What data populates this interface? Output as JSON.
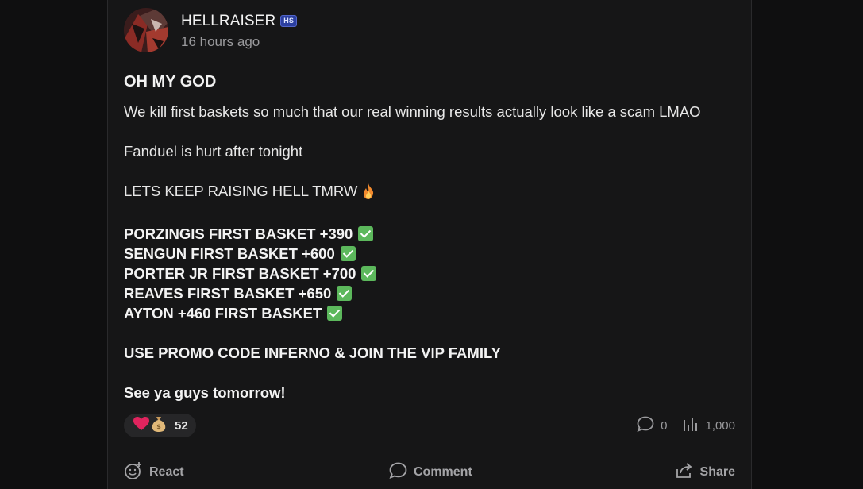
{
  "post": {
    "author": "HELLRAISER",
    "badge": "HS",
    "timestamp": "16 hours ago",
    "title": "OH MY GOD",
    "paragraphs": {
      "p1": "We kill first baskets so much that our real winning results actually look like a scam LMAO",
      "p2": "Fanduel is hurt after tonight",
      "p3": "LETS KEEP RAISING HELL TMRW"
    },
    "picks": [
      "PORZINGIS FIRST BASKET +390",
      "SENGUN FIRST BASKET +600",
      "PORTER JR FIRST BASKET +700",
      "REAVES FIRST BASKET +650",
      "AYTON +460 FIRST BASKET"
    ],
    "promo": "USE PROMO CODE INFERNO & JOIN THE VIP FAMILY",
    "signoff": "See ya guys tomorrow!"
  },
  "reactions": {
    "icons": [
      "heart-icon",
      "money-bag-icon"
    ],
    "count": "52"
  },
  "stats": {
    "comments": "0",
    "views": "1,000"
  },
  "actions": {
    "react": "React",
    "comment": "Comment",
    "share": "Share"
  },
  "colors": {
    "background": "#161617",
    "check": "#5cb85c",
    "badge": "#2b3fa0",
    "heart": "#e0245e"
  }
}
